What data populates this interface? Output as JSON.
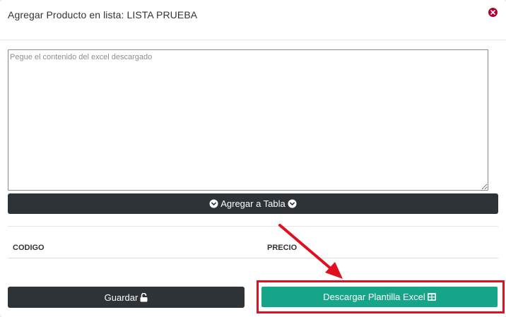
{
  "modal": {
    "title": "Agregar Producto en lista: LISTA PRUEBA"
  },
  "paste_area": {
    "placeholder": "Pegue el contenido del excel descargado",
    "value": ""
  },
  "add_table_button": {
    "label": "Agregar a Tabla",
    "icon": "circle-chevron-down-icon"
  },
  "table": {
    "columns": [
      "CODIGO",
      "PRECIO"
    ],
    "rows": []
  },
  "save_button": {
    "label": "Guardar",
    "icon": "unlock-icon"
  },
  "download_button": {
    "label": "Descargar Plantilla Excel",
    "icon": "table-icon"
  },
  "colors": {
    "dark_button": "#2e3338",
    "download_button": "#17a589",
    "close_icon": "#b1002c",
    "annotation": "#e0101e"
  }
}
